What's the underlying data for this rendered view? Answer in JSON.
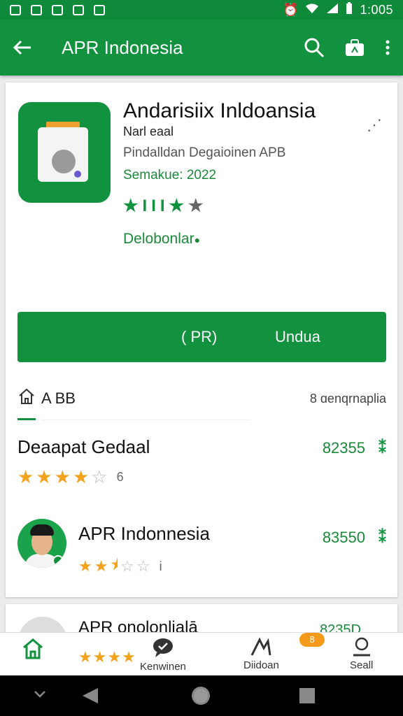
{
  "status_bar": {
    "time": "1:005"
  },
  "app_bar": {
    "title": "APR Indonesia",
    "icons": [
      "back-arrow-icon",
      "search-icon",
      "share-icon",
      "more-vert-icon"
    ]
  },
  "app": {
    "name": "Andarisiix Inldoansia",
    "developer": "Narl eaal",
    "category": "Pindalldan Degaioinen APB",
    "update": "Semakue: 2022",
    "download_link": "Delobonlar",
    "colors": {
      "accent": "#12913f",
      "star": "#f3a21d"
    }
  },
  "install_button": {
    "prefix": "( PR)",
    "label": "Undua"
  },
  "section": {
    "title": "A BB",
    "right_text": "8 ɑenqrnaplia"
  },
  "reviews": [
    {
      "name": "Deaapat Gedaal",
      "count": "82355",
      "rating": 4,
      "max": 5,
      "meta": "6"
    },
    {
      "name": "APR Indonnesia",
      "count": "83550",
      "rating": 2.5,
      "max": 5,
      "meta": "i"
    }
  ],
  "peek_item": {
    "name": "APR onolonlialā",
    "count": "8235D"
  },
  "bottom_nav": {
    "home_label": "",
    "chat_label": "Kenwinen",
    "download_label": "Diidoan",
    "badge": "8",
    "search_label": "Seall"
  }
}
